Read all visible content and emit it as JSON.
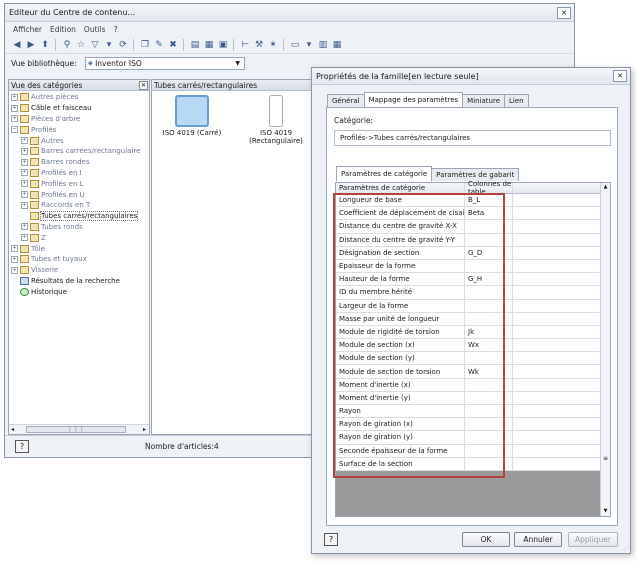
{
  "main": {
    "title": "Editeur du Centre de contenu...",
    "menu": [
      "Afficher",
      "Edition",
      "Outils",
      "?"
    ],
    "library_label": "Vue bibliothèque:",
    "library_value": "Inventor ISO",
    "tree_header": "Vue des catégories",
    "content_header": "Tubes carrés/rectangulaires",
    "tree": [
      {
        "label": "Autres pièces",
        "level": 0,
        "exp": "+",
        "dim": true
      },
      {
        "label": "Câble et faisceau",
        "level": 0,
        "exp": "+",
        "dim": false
      },
      {
        "label": "Pièces d'arbre",
        "level": 0,
        "exp": "+",
        "dim": true
      },
      {
        "label": "Profilés",
        "level": 0,
        "exp": "−",
        "dim": true
      },
      {
        "label": "Autres",
        "level": 1,
        "exp": "+",
        "dim": true
      },
      {
        "label": "Barres carrées/rectangulaire",
        "level": 1,
        "exp": "+",
        "dim": true
      },
      {
        "label": "Barres rondes",
        "level": 1,
        "exp": "+",
        "dim": true
      },
      {
        "label": "Profilés en I",
        "level": 1,
        "exp": "+",
        "dim": true
      },
      {
        "label": "Profilés en L",
        "level": 1,
        "exp": "+",
        "dim": true
      },
      {
        "label": "Profilés en U",
        "level": 1,
        "exp": "+",
        "dim": true
      },
      {
        "label": "Raccords en T",
        "level": 1,
        "exp": "+",
        "dim": true
      },
      {
        "label": "Tubes carrés/rectangulaires",
        "level": 1,
        "exp": "",
        "dim": false,
        "sel": true
      },
      {
        "label": "Tubes ronds",
        "level": 1,
        "exp": "+",
        "dim": true
      },
      {
        "label": "Z",
        "level": 1,
        "exp": "+",
        "dim": true
      },
      {
        "label": "Tôle",
        "level": 0,
        "exp": "+",
        "dim": true
      },
      {
        "label": "Tubes et tuyaux",
        "level": 0,
        "exp": "+",
        "dim": true
      },
      {
        "label": "Visserie",
        "level": 0,
        "exp": "+",
        "dim": true
      },
      {
        "label": "Résultats de la recherche",
        "level": 0,
        "exp": "",
        "dim": false
      },
      {
        "label": "Historique",
        "level": 0,
        "exp": "",
        "dim": false
      }
    ],
    "items": [
      {
        "label": "ISO 4019 (Carré)"
      },
      {
        "label": "ISO 4019 (Rectangulaire)"
      }
    ],
    "status_text": "Nombre d'articles:4",
    "help_label": "?"
  },
  "dialog": {
    "title": "Propriétés de la famille[en lecture seule]",
    "tabs": [
      "Général",
      "Mappage des paramètres",
      "Miniature",
      "Lien"
    ],
    "active_tab": 1,
    "category_label": "Catégorie:",
    "category_value": "Profilés->Tubes carrés/rectangulaires",
    "subtabs": [
      "Paramètres de catégorie",
      "Paramètres de gabarit"
    ],
    "grid_headers": [
      "Paramètres de catégorie",
      "Colonnes de table"
    ],
    "rows": [
      {
        "param": "Longueur de base",
        "col": "B_L"
      },
      {
        "param": "Coefficient de déplacement de cisai...",
        "col": "Beta"
      },
      {
        "param": "Distance du centre de gravité X-X",
        "col": ""
      },
      {
        "param": "Distance du centre de gravité Y-Y",
        "col": ""
      },
      {
        "param": "Désignation de section",
        "col": "G_D"
      },
      {
        "param": "Epaisseur de la forme",
        "col": ""
      },
      {
        "param": "Hauteur de la forme",
        "col": "G_H"
      },
      {
        "param": "ID du membre hérité",
        "col": ""
      },
      {
        "param": "Largeur de la forme",
        "col": ""
      },
      {
        "param": "Masse par unité de longueur",
        "col": ""
      },
      {
        "param": "Module de rigidité de torsion",
        "col": "Jk"
      },
      {
        "param": "Module de section (x)",
        "col": "Wx"
      },
      {
        "param": "Module de section (y)",
        "col": ""
      },
      {
        "param": "Module de section de torsion",
        "col": "Wk"
      },
      {
        "param": "Moment d'inertie (x)",
        "col": ""
      },
      {
        "param": "Moment d'inertie (y)",
        "col": ""
      },
      {
        "param": "Rayon",
        "col": ""
      },
      {
        "param": "Rayon de giration (x)",
        "col": ""
      },
      {
        "param": "Rayon de giration (y)",
        "col": ""
      },
      {
        "param": "Seconde épaisseur de la forme",
        "col": ""
      },
      {
        "param": "Surface de la section",
        "col": ""
      }
    ],
    "ok_label": "OK",
    "cancel_label": "Annuler",
    "apply_label": "Appliquer",
    "help_label": "?"
  },
  "colors": {
    "highlight": "#b3413f",
    "window_bg": "#eef1f6"
  }
}
